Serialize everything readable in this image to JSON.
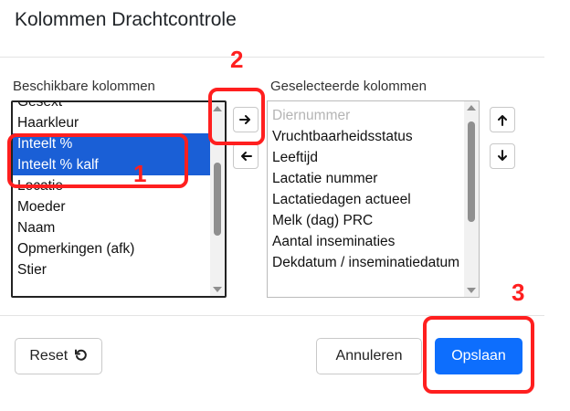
{
  "dialog": {
    "title": "Kolommen Drachtcontrole"
  },
  "available": {
    "label": "Beschikbare kolommen",
    "items": [
      "Gesext",
      "Haarkleur",
      "Inteelt %",
      "Inteelt % kalf",
      "Locatie",
      "Moeder",
      "Naam",
      "Opmerkingen (afk)",
      "Stier"
    ]
  },
  "selected": {
    "label": "Geselecteerde kolommen",
    "items": [
      "Diernummer",
      "Vruchtbaarheidsstatus",
      "Leeftijd",
      "Lactatie nummer",
      "Lactatiedagen actueel",
      "Melk (dag) PRC",
      "Aantal inseminaties",
      "Dekdatum / inseminatiedatum"
    ]
  },
  "icons": {
    "move_right": "arrow-right-icon",
    "move_left": "arrow-left-icon",
    "move_up": "arrow-up-icon",
    "move_down": "arrow-down-icon",
    "reset": "reset-rotate-icon"
  },
  "footer": {
    "reset_label": "Reset",
    "cancel_label": "Annuleren",
    "save_label": "Opslaan"
  },
  "annotations": {
    "n1": "1",
    "n2": "2",
    "n3": "3"
  },
  "colors": {
    "selection": "#1a5fd6",
    "primary": "#0d6efd",
    "annotation": "#ff1f1f"
  }
}
